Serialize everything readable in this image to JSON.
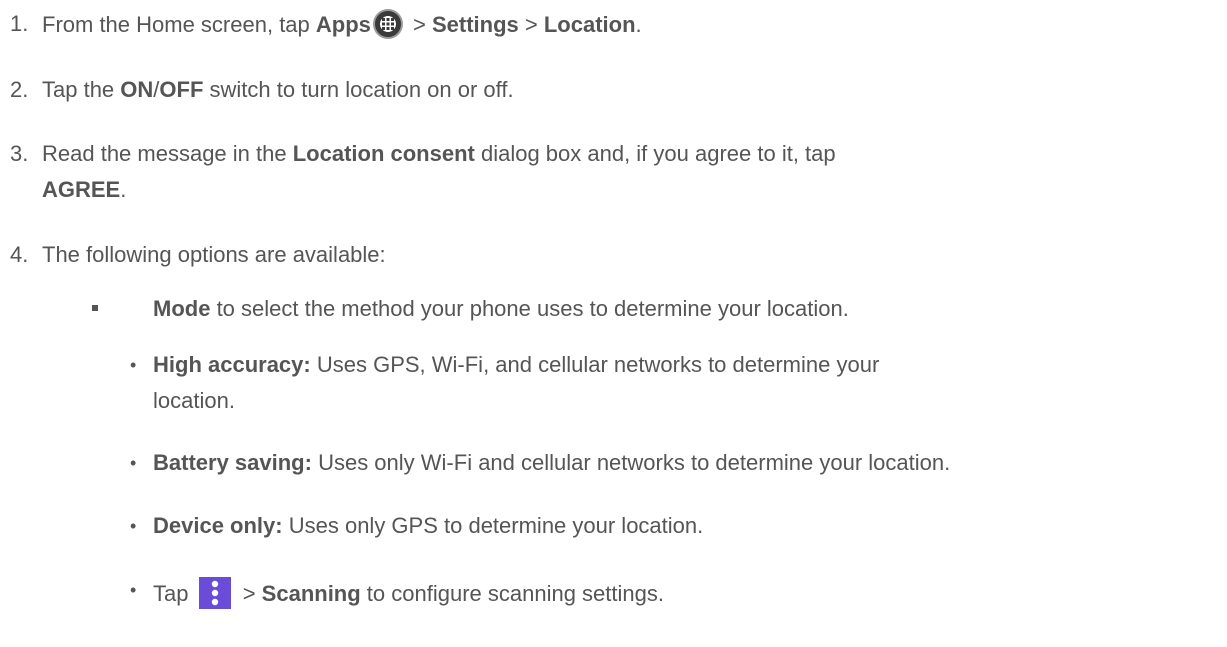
{
  "steps": [
    {
      "number": "1.",
      "parts": {
        "t1": "From the Home screen, tap ",
        "apps": "Apps",
        "t2": " > ",
        "settings": "Settings",
        "t3": " > ",
        "location": "Location",
        "t4": "."
      }
    },
    {
      "number": "2.",
      "parts": {
        "t1": "Tap the ",
        "on": "ON",
        "slash": "/",
        "off": "OFF",
        "t2": " switch to turn location on or off."
      }
    },
    {
      "number": "3.",
      "parts": {
        "t1": "Read the message in the ",
        "consent": "Location consent",
        "t2": " dialog box and, if you agree to it, tap",
        "agree": "AGREE",
        "t3": "."
      }
    },
    {
      "number": "4.",
      "parts": {
        "t1": "The following options are available:"
      }
    }
  ],
  "mode_item": {
    "bold": "Mode",
    "text": " to select the method your phone uses to determine your location."
  },
  "sub_items": [
    {
      "bullet": "•",
      "bold": "High accuracy:",
      "text": " Uses GPS, Wi-Fi, and cellular networks to determine your",
      "text2": "location."
    },
    {
      "bullet": "•",
      "bold": "Battery saving:",
      "text": " Uses only Wi-Fi and cellular networks to determine your location."
    },
    {
      "bullet": "•",
      "bold": "Device only:",
      "text": " Uses only GPS to determine your location."
    },
    {
      "bullet": "•",
      "pre": "Tap ",
      "post": " > ",
      "bold": "Scanning",
      "text": " to configure scanning settings."
    }
  ],
  "icons": {
    "apps": "apps-grid-icon",
    "menu": "overflow-menu-icon"
  },
  "colors": {
    "text": "#555555",
    "menu_icon_bg": "#6a4cd8"
  }
}
